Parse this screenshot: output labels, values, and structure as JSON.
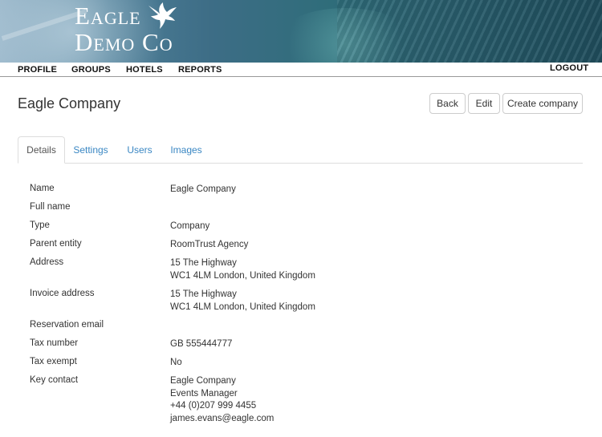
{
  "brand": {
    "line1": "Eagle",
    "line2": "Demo Co",
    "logo_icon": "eagle-icon"
  },
  "nav": {
    "items": [
      "PROFILE",
      "GROUPS",
      "HOTELS",
      "REPORTS"
    ],
    "logout": "LOGOUT"
  },
  "page": {
    "title": "Eagle Company",
    "buttons": [
      "Back",
      "Edit",
      "Create company"
    ]
  },
  "tabs": {
    "items": [
      "Details",
      "Settings",
      "Users",
      "Images"
    ],
    "active": "Details"
  },
  "details": [
    {
      "label": "Name",
      "value": [
        "Eagle Company"
      ]
    },
    {
      "label": "Full name",
      "value": []
    },
    {
      "label": "Type",
      "value": [
        "Company"
      ]
    },
    {
      "label": "Parent entity",
      "value": [
        "RoomTrust Agency"
      ]
    },
    {
      "label": "Address",
      "value": [
        "15 The Highway",
        "WC1 4LM London, United Kingdom"
      ]
    },
    {
      "label": "Invoice address",
      "value": [
        "15 The Highway",
        "WC1 4LM London, United Kingdom"
      ]
    },
    {
      "label": "Reservation email",
      "value": []
    },
    {
      "label": "Tax number",
      "value": [
        "GB 555444777"
      ]
    },
    {
      "label": "Tax exempt",
      "value": [
        "No"
      ]
    },
    {
      "label": "Key contact",
      "value": [
        "Eagle Company",
        "Events Manager",
        "+44 (0)207 999 4455",
        "james.evans@eagle.com"
      ]
    }
  ],
  "colors": {
    "link": "#3a87c3",
    "text": "#333333",
    "border": "#dddddd"
  }
}
